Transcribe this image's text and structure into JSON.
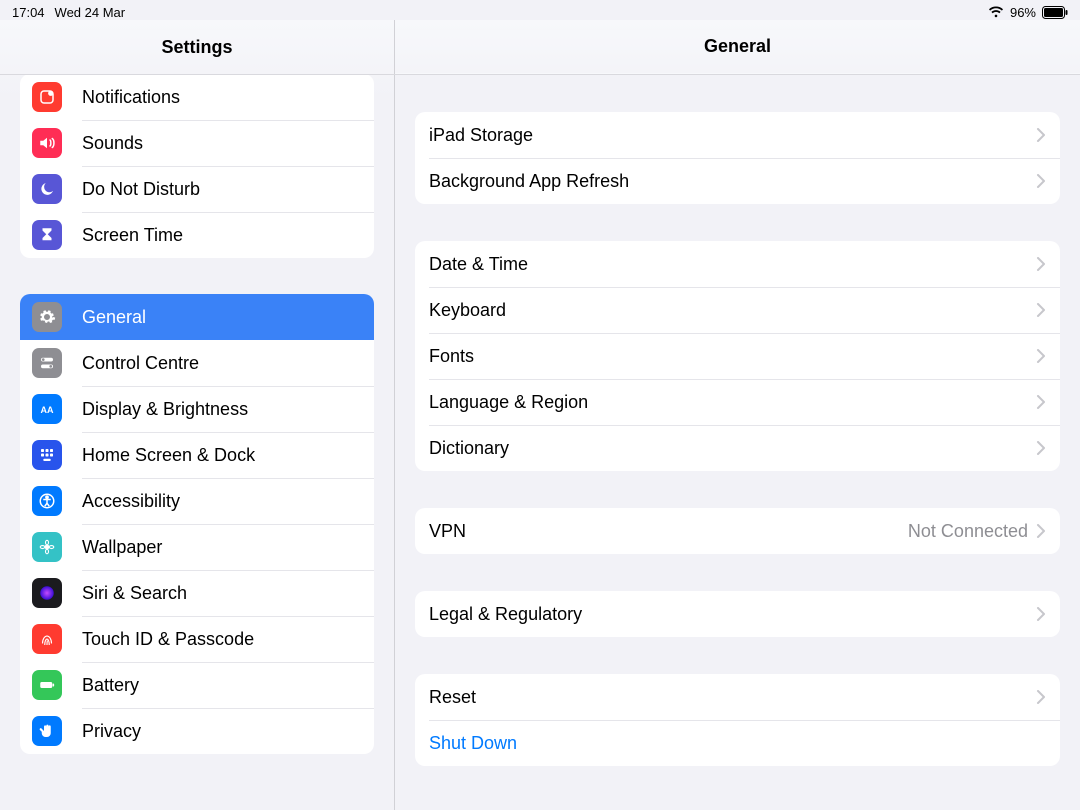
{
  "statusbar": {
    "time": "17:04",
    "date": "Wed 24 Mar",
    "battery_percent": "96%"
  },
  "sidebar": {
    "title": "Settings",
    "groups": [
      [
        {
          "id": "notifications",
          "label": "Notifications",
          "col": "#ff3b30"
        },
        {
          "id": "sounds",
          "label": "Sounds",
          "col": "#ff2d55"
        },
        {
          "id": "dnd",
          "label": "Do Not Disturb",
          "col": "#5856d6"
        },
        {
          "id": "screentime",
          "label": "Screen Time",
          "col": "#5856d6"
        }
      ],
      [
        {
          "id": "general",
          "label": "General",
          "col": "#8e8e93",
          "selected": true
        },
        {
          "id": "controlcentre",
          "label": "Control Centre",
          "col": "#8e8e93"
        },
        {
          "id": "display",
          "label": "Display & Brightness",
          "col": "#007aff"
        },
        {
          "id": "homescreen",
          "label": "Home Screen & Dock",
          "col": "#2854ec"
        },
        {
          "id": "accessibility",
          "label": "Accessibility",
          "col": "#007aff"
        },
        {
          "id": "wallpaper",
          "label": "Wallpaper",
          "col": "#34c2c6"
        },
        {
          "id": "siri",
          "label": "Siri & Search",
          "col": "#1b1b1f"
        },
        {
          "id": "touchid",
          "label": "Touch ID & Passcode",
          "col": "#ff3b30"
        },
        {
          "id": "battery",
          "label": "Battery",
          "col": "#34c759"
        },
        {
          "id": "privacy",
          "label": "Privacy",
          "col": "#007aff"
        }
      ]
    ]
  },
  "content": {
    "title": "General",
    "sections": [
      [
        {
          "id": "storage",
          "label": "iPad Storage",
          "chevron": true
        },
        {
          "id": "bgrefresh",
          "label": "Background App Refresh",
          "chevron": true
        }
      ],
      [
        {
          "id": "datetime",
          "label": "Date & Time",
          "chevron": true
        },
        {
          "id": "keyboard",
          "label": "Keyboard",
          "chevron": true
        },
        {
          "id": "fonts",
          "label": "Fonts",
          "chevron": true
        },
        {
          "id": "langregion",
          "label": "Language & Region",
          "chevron": true
        },
        {
          "id": "dictionary",
          "label": "Dictionary",
          "chevron": true
        }
      ],
      [
        {
          "id": "vpn",
          "label": "VPN",
          "value": "Not Connected",
          "chevron": true
        }
      ],
      [
        {
          "id": "legal",
          "label": "Legal & Regulatory",
          "chevron": true
        }
      ],
      [
        {
          "id": "reset",
          "label": "Reset",
          "chevron": true
        },
        {
          "id": "shutdown",
          "label": "Shut Down",
          "link": true
        }
      ]
    ]
  },
  "icons": {
    "notifications": "notif",
    "sounds": "sound",
    "dnd": "moon",
    "screentime": "hourglass",
    "general": "gear",
    "controlcentre": "switches",
    "display": "aa",
    "homescreen": "grid",
    "accessibility": "access",
    "wallpaper": "flower",
    "siri": "siri",
    "touchid": "finger",
    "battery": "battery",
    "privacy": "hand"
  }
}
